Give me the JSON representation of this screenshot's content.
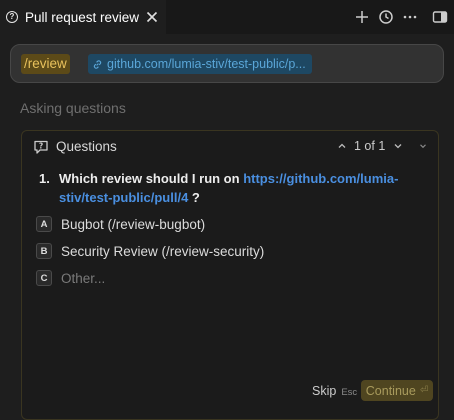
{
  "tab": {
    "title": "Pull request review",
    "icon": "help-circle-icon"
  },
  "toolbar": {
    "icons": [
      "plus-icon",
      "history-icon",
      "more-icon",
      "panel-toggle-icon"
    ]
  },
  "composer": {
    "command": "/review",
    "link_text": "github.com/lumia-stiv/test-public/p..."
  },
  "status": "Asking questions",
  "questions": {
    "title": "Questions",
    "pager": "1 of 1",
    "question": {
      "number": "1.",
      "text_before": "Which review should I run on ",
      "link": "https://github.com/lumia-stiv/test-public/pull/4",
      "text_after": " ?"
    },
    "options": [
      {
        "key": "A",
        "label": "Bugbot (/review-bugbot)"
      },
      {
        "key": "B",
        "label": "Security Review (/review-security)"
      },
      {
        "key": "C",
        "label": "Other..."
      }
    ],
    "skip_label": "Skip",
    "skip_hint": "Esc",
    "continue_label": "Continue",
    "continue_hint": "⏎"
  },
  "colors": {
    "accent": "#4a8fe0",
    "command_pill": "#5c4a18",
    "continue_bg": "#4f4520"
  }
}
